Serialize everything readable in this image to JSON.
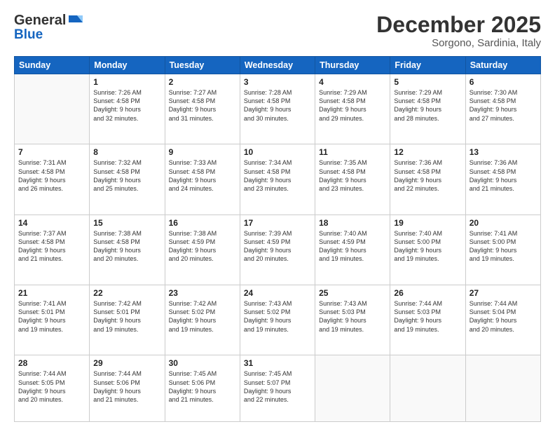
{
  "logo": {
    "general": "General",
    "blue": "Blue"
  },
  "header": {
    "month": "December 2025",
    "location": "Sorgono, Sardinia, Italy"
  },
  "days_of_week": [
    "Sunday",
    "Monday",
    "Tuesday",
    "Wednesday",
    "Thursday",
    "Friday",
    "Saturday"
  ],
  "weeks": [
    [
      {
        "day": "",
        "content": ""
      },
      {
        "day": "1",
        "content": "Sunrise: 7:26 AM\nSunset: 4:58 PM\nDaylight: 9 hours\nand 32 minutes."
      },
      {
        "day": "2",
        "content": "Sunrise: 7:27 AM\nSunset: 4:58 PM\nDaylight: 9 hours\nand 31 minutes."
      },
      {
        "day": "3",
        "content": "Sunrise: 7:28 AM\nSunset: 4:58 PM\nDaylight: 9 hours\nand 30 minutes."
      },
      {
        "day": "4",
        "content": "Sunrise: 7:29 AM\nSunset: 4:58 PM\nDaylight: 9 hours\nand 29 minutes."
      },
      {
        "day": "5",
        "content": "Sunrise: 7:29 AM\nSunset: 4:58 PM\nDaylight: 9 hours\nand 28 minutes."
      },
      {
        "day": "6",
        "content": "Sunrise: 7:30 AM\nSunset: 4:58 PM\nDaylight: 9 hours\nand 27 minutes."
      }
    ],
    [
      {
        "day": "7",
        "content": "Sunrise: 7:31 AM\nSunset: 4:58 PM\nDaylight: 9 hours\nand 26 minutes."
      },
      {
        "day": "8",
        "content": "Sunrise: 7:32 AM\nSunset: 4:58 PM\nDaylight: 9 hours\nand 25 minutes."
      },
      {
        "day": "9",
        "content": "Sunrise: 7:33 AM\nSunset: 4:58 PM\nDaylight: 9 hours\nand 24 minutes."
      },
      {
        "day": "10",
        "content": "Sunrise: 7:34 AM\nSunset: 4:58 PM\nDaylight: 9 hours\nand 23 minutes."
      },
      {
        "day": "11",
        "content": "Sunrise: 7:35 AM\nSunset: 4:58 PM\nDaylight: 9 hours\nand 23 minutes."
      },
      {
        "day": "12",
        "content": "Sunrise: 7:36 AM\nSunset: 4:58 PM\nDaylight: 9 hours\nand 22 minutes."
      },
      {
        "day": "13",
        "content": "Sunrise: 7:36 AM\nSunset: 4:58 PM\nDaylight: 9 hours\nand 21 minutes."
      }
    ],
    [
      {
        "day": "14",
        "content": "Sunrise: 7:37 AM\nSunset: 4:58 PM\nDaylight: 9 hours\nand 21 minutes."
      },
      {
        "day": "15",
        "content": "Sunrise: 7:38 AM\nSunset: 4:58 PM\nDaylight: 9 hours\nand 20 minutes."
      },
      {
        "day": "16",
        "content": "Sunrise: 7:38 AM\nSunset: 4:59 PM\nDaylight: 9 hours\nand 20 minutes."
      },
      {
        "day": "17",
        "content": "Sunrise: 7:39 AM\nSunset: 4:59 PM\nDaylight: 9 hours\nand 20 minutes."
      },
      {
        "day": "18",
        "content": "Sunrise: 7:40 AM\nSunset: 4:59 PM\nDaylight: 9 hours\nand 19 minutes."
      },
      {
        "day": "19",
        "content": "Sunrise: 7:40 AM\nSunset: 5:00 PM\nDaylight: 9 hours\nand 19 minutes."
      },
      {
        "day": "20",
        "content": "Sunrise: 7:41 AM\nSunset: 5:00 PM\nDaylight: 9 hours\nand 19 minutes."
      }
    ],
    [
      {
        "day": "21",
        "content": "Sunrise: 7:41 AM\nSunset: 5:01 PM\nDaylight: 9 hours\nand 19 minutes."
      },
      {
        "day": "22",
        "content": "Sunrise: 7:42 AM\nSunset: 5:01 PM\nDaylight: 9 hours\nand 19 minutes."
      },
      {
        "day": "23",
        "content": "Sunrise: 7:42 AM\nSunset: 5:02 PM\nDaylight: 9 hours\nand 19 minutes."
      },
      {
        "day": "24",
        "content": "Sunrise: 7:43 AM\nSunset: 5:02 PM\nDaylight: 9 hours\nand 19 minutes."
      },
      {
        "day": "25",
        "content": "Sunrise: 7:43 AM\nSunset: 5:03 PM\nDaylight: 9 hours\nand 19 minutes."
      },
      {
        "day": "26",
        "content": "Sunrise: 7:44 AM\nSunset: 5:03 PM\nDaylight: 9 hours\nand 19 minutes."
      },
      {
        "day": "27",
        "content": "Sunrise: 7:44 AM\nSunset: 5:04 PM\nDaylight: 9 hours\nand 20 minutes."
      }
    ],
    [
      {
        "day": "28",
        "content": "Sunrise: 7:44 AM\nSunset: 5:05 PM\nDaylight: 9 hours\nand 20 minutes."
      },
      {
        "day": "29",
        "content": "Sunrise: 7:44 AM\nSunset: 5:06 PM\nDaylight: 9 hours\nand 21 minutes."
      },
      {
        "day": "30",
        "content": "Sunrise: 7:45 AM\nSunset: 5:06 PM\nDaylight: 9 hours\nand 21 minutes."
      },
      {
        "day": "31",
        "content": "Sunrise: 7:45 AM\nSunset: 5:07 PM\nDaylight: 9 hours\nand 22 minutes."
      },
      {
        "day": "",
        "content": ""
      },
      {
        "day": "",
        "content": ""
      },
      {
        "day": "",
        "content": ""
      }
    ]
  ]
}
